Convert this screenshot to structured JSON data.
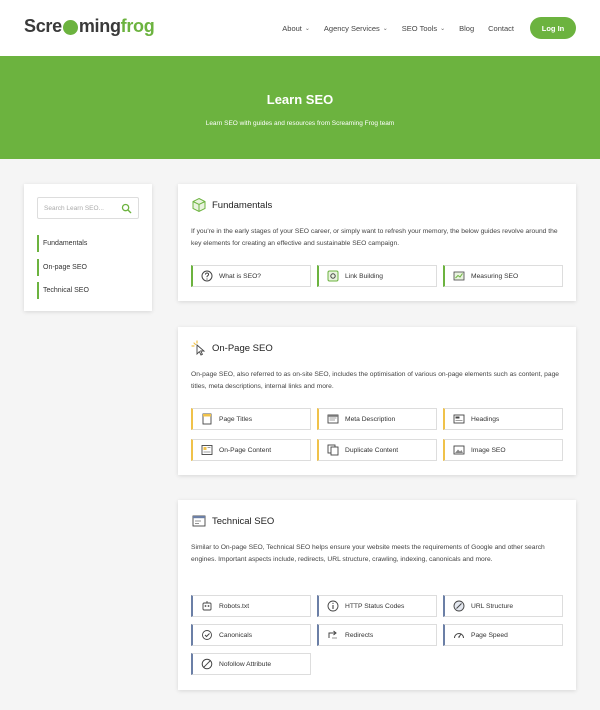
{
  "header": {
    "logo": {
      "part1": "Scre",
      "part2": "ming",
      "part3": "frog"
    },
    "nav": [
      {
        "label": "About",
        "dropdown": true
      },
      {
        "label": "Agency Services",
        "dropdown": true
      },
      {
        "label": "SEO Tools",
        "dropdown": true
      },
      {
        "label": "Blog",
        "dropdown": false
      },
      {
        "label": "Contact",
        "dropdown": false
      }
    ],
    "login_label": "Log In",
    "chevron": "⌄"
  },
  "hero": {
    "title": "Learn SEO",
    "subtitle": "Learn SEO with guides and resources from Screaming Frog team"
  },
  "sidebar": {
    "search_placeholder": "Search Learn SEO...",
    "items": [
      {
        "label": "Fundamentals"
      },
      {
        "label": "On-page SEO"
      },
      {
        "label": "Technical SEO"
      }
    ]
  },
  "sections": {
    "fundamentals": {
      "title": "Fundamentals",
      "description": "If you're in the early stages of your SEO career, or simply want to refresh your memory, the below guides revolve around the key elements for creating an effective and sustainable SEO campaign.",
      "tiles": [
        {
          "label": "What is SEO?",
          "icon": "question-icon"
        },
        {
          "label": "Link Building",
          "icon": "link-icon"
        },
        {
          "label": "Measuring SEO",
          "icon": "chart-icon"
        }
      ]
    },
    "onpage": {
      "title": "On-Page SEO",
      "description": "On-page SEO, also referred to as on-site SEO, includes the optimisation of various on-page elements such as content, page titles, meta descriptions, internal links and more.",
      "tiles": [
        {
          "label": "Page Titles",
          "icon": "page-icon"
        },
        {
          "label": "Meta Description",
          "icon": "meta-icon"
        },
        {
          "label": "Headings",
          "icon": "heading-icon"
        },
        {
          "label": "On-Page Content",
          "icon": "content-icon"
        },
        {
          "label": "Duplicate Content",
          "icon": "duplicate-icon"
        },
        {
          "label": "Image SEO",
          "icon": "image-icon"
        }
      ]
    },
    "technical": {
      "title": "Technical SEO",
      "description": "Similar to On-page SEO, Technical SEO helps ensure your website meets the requirements of Google and other search engines. Important aspects include, redirects, URL structure, crawling, indexing, canonicals and more.",
      "tiles": [
        {
          "label": "Robots.txt",
          "icon": "robot-icon"
        },
        {
          "label": "HTTP Status Codes",
          "icon": "info-icon"
        },
        {
          "label": "URL Structure",
          "icon": "url-icon"
        },
        {
          "label": "Canonicals",
          "icon": "canonical-icon"
        },
        {
          "label": "Redirects",
          "icon": "redirect-icon"
        },
        {
          "label": "Page Speed",
          "icon": "speed-icon"
        },
        {
          "label": "Nofollow Attribute",
          "icon": "nofollow-icon"
        }
      ]
    }
  },
  "colors": {
    "brand_green": "#6cb33f",
    "onpage_yellow": "#f0c24a",
    "technical_blue": "#6b7fa6"
  }
}
